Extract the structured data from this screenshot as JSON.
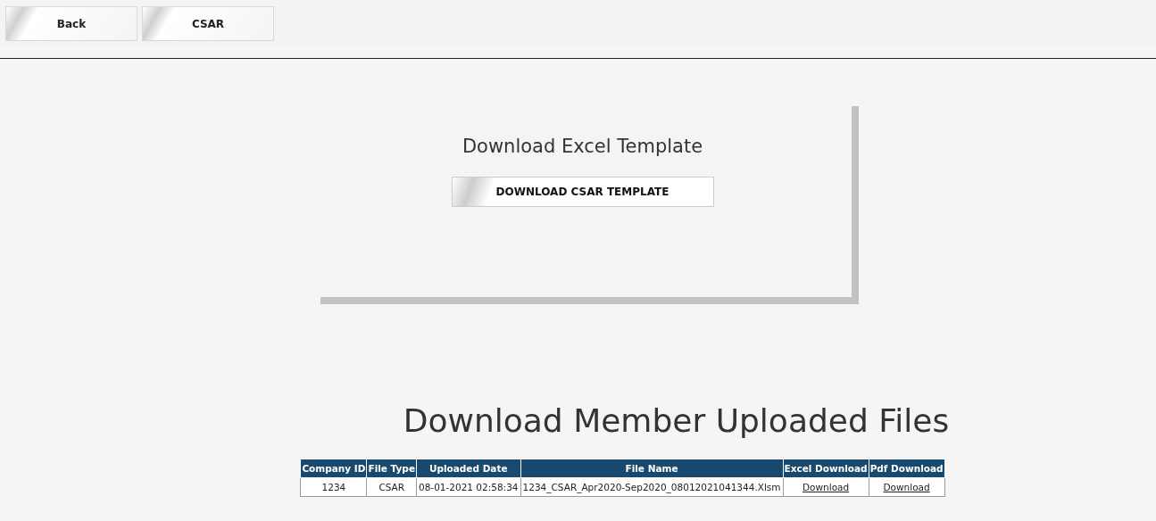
{
  "toolbar": {
    "buttons": [
      "Back",
      "CSAR"
    ]
  },
  "template_card": {
    "title": "Download Excel Template",
    "button": "DOWNLOAD CSAR TEMPLATE"
  },
  "uploads": {
    "title": "Download Member Uploaded Files",
    "table": {
      "columns": [
        "Company ID",
        "File Type",
        "Uploaded Date",
        "File Name",
        "Excel Download",
        "Pdf Download"
      ],
      "rows": [
        {
          "cells": [
            "1234",
            "CSAR",
            "08-01-2021 02:58:34",
            "1234_CSAR_Apr2020-Sep2020_08012021041344.Xlsm"
          ],
          "links": [
            "Download",
            "Download"
          ]
        }
      ]
    }
  }
}
